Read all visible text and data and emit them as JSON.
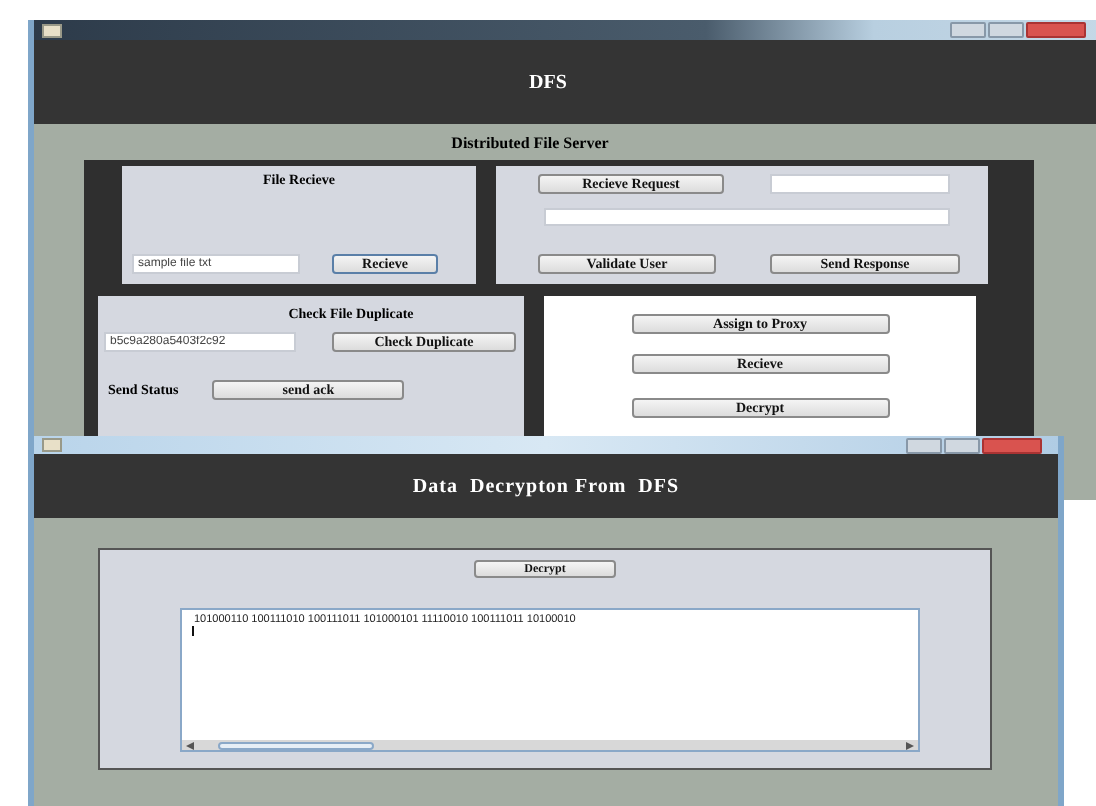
{
  "main_window": {
    "header": "DFS",
    "subtitle": "Distributed File Server",
    "file_receive": {
      "title": "File Recieve",
      "filename": "sample file txt",
      "button": "Recieve"
    },
    "request": {
      "request_button": "Recieve Request",
      "validate_button": "Validate User",
      "send_button": "Send Response"
    },
    "duplicate": {
      "title": "Check File Duplicate",
      "hash": "b5c9a280a5403f2c92",
      "button": "Check Duplicate",
      "status_label": "Send Status",
      "ack_button": "send ack"
    },
    "actions": [
      "Assign to Proxy",
      "Recieve",
      "Decrypt"
    ]
  },
  "decrypt_window": {
    "header": "Data  Decrypton From  DFS",
    "button": "Decrypt",
    "output": "101000110 100111010 100111011 101000101 11110010 100111011 10100010"
  }
}
